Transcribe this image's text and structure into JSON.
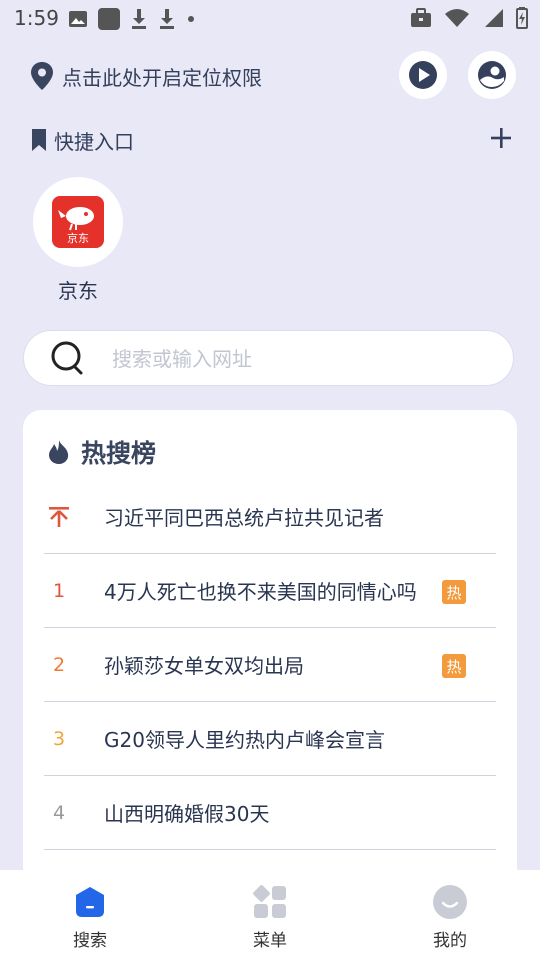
{
  "status_bar": {
    "time": "1:59"
  },
  "location": {
    "text": "点击此处开启定位权限"
  },
  "shortcuts": {
    "title": "快捷入口",
    "apps": [
      {
        "label": "京东",
        "icon_text": "京东"
      }
    ]
  },
  "search": {
    "placeholder": "搜索或输入网址"
  },
  "hot_list": {
    "title": "热搜榜",
    "items": [
      {
        "rank": "",
        "text": "习近平同巴西总统卢拉共见记者",
        "badge": ""
      },
      {
        "rank": "1",
        "text": "4万人死亡也换不来美国的同情心吗",
        "badge": "热"
      },
      {
        "rank": "2",
        "text": "孙颖莎女单女双均出局",
        "badge": "热"
      },
      {
        "rank": "3",
        "text": "G20领导人里约热内卢峰会宣言",
        "badge": ""
      },
      {
        "rank": "4",
        "text": "山西明确婚假30天",
        "badge": ""
      }
    ]
  },
  "bottom_nav": [
    {
      "label": "搜索"
    },
    {
      "label": "菜单"
    },
    {
      "label": "我的"
    }
  ],
  "colors": {
    "background": "#e8e8f7",
    "accent_blue": "#2466e8",
    "rank_1": "#e0563b",
    "rank_2": "#ef7a33",
    "rank_3": "#f0a53a",
    "rank_other": "#999999",
    "badge": "#f39a3d",
    "jd_red": "#e4322b"
  }
}
